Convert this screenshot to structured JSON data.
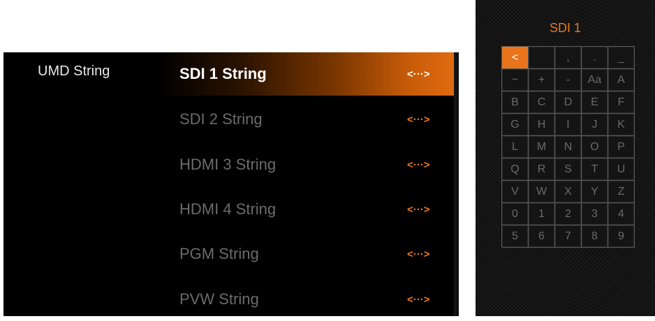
{
  "menu": {
    "title": "UMD String",
    "rows": [
      {
        "label": "SDI 1 String",
        "value": "<···>",
        "selected": true
      },
      {
        "label": "SDI 2 String",
        "value": "<···>",
        "selected": false
      },
      {
        "label": "HDMI 3 String",
        "value": "<···>",
        "selected": false
      },
      {
        "label": "HDMI 4 String",
        "value": "<···>",
        "selected": false
      },
      {
        "label": "PGM String",
        "value": "<···>",
        "selected": false
      },
      {
        "label": "PVW String",
        "value": "<···>",
        "selected": false
      }
    ]
  },
  "keyboard": {
    "title": "SDI 1",
    "keys": [
      "<",
      "",
      ",",
      ".",
      "_",
      "~",
      "+",
      "-",
      "Aa",
      "A",
      "B",
      "C",
      "D",
      "E",
      "F",
      "G",
      "H",
      "I",
      "J",
      "K",
      "L",
      "M",
      "N",
      "O",
      "P",
      "Q",
      "R",
      "S",
      "T",
      "U",
      "V",
      "W",
      "X",
      "Y",
      "Z",
      "0",
      "1",
      "2",
      "3",
      "4",
      "5",
      "6",
      "7",
      "8",
      "9"
    ],
    "active_key": "<"
  },
  "colors": {
    "accent": "#e9741c",
    "background": "#000000",
    "inactive_text": "#6b6b6b"
  }
}
